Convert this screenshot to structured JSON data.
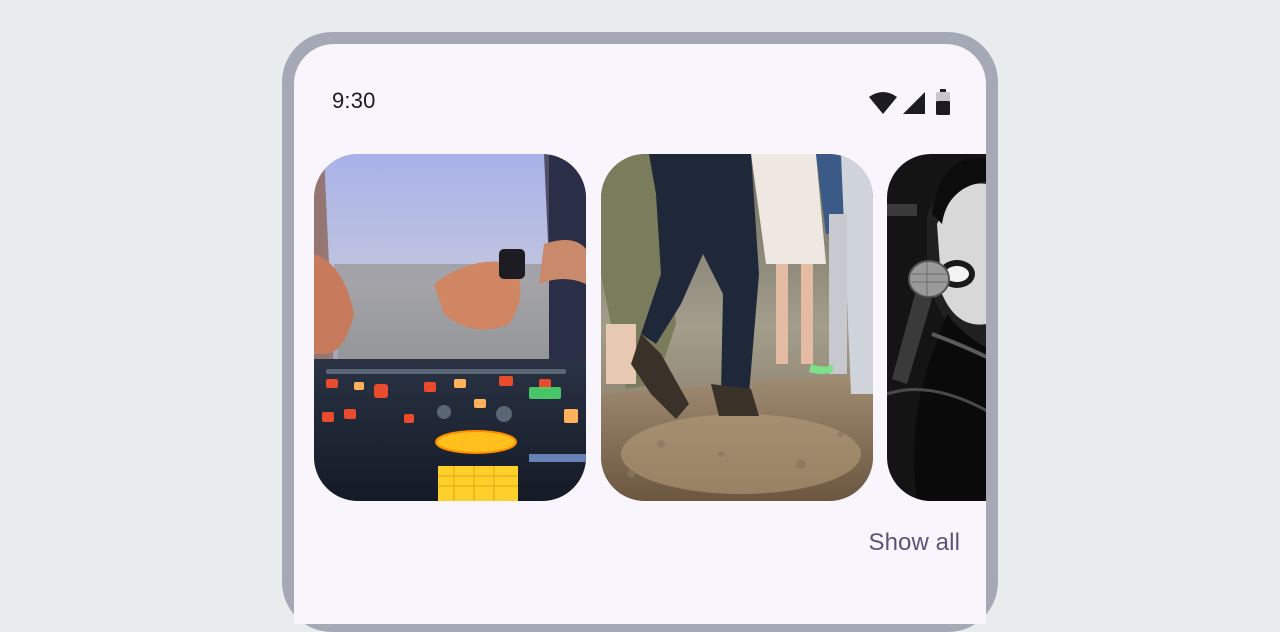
{
  "status_bar": {
    "time": "9:30",
    "icons": [
      "wifi-icon",
      "cellular-signal-icon",
      "battery-icon"
    ]
  },
  "carousel": {
    "items": [
      {
        "image": "dj-mixer-console-photo"
      },
      {
        "image": "crowd-dancing-dust-photo"
      },
      {
        "image": "singer-microphone-bw-photo"
      }
    ]
  },
  "footer": {
    "show_all_label": "Show all"
  },
  "colors": {
    "page_background": "#e9ecee",
    "device_frame": "#a5a9b5",
    "screen_background": "#f8f5fd",
    "link_text": "#5c5478"
  }
}
